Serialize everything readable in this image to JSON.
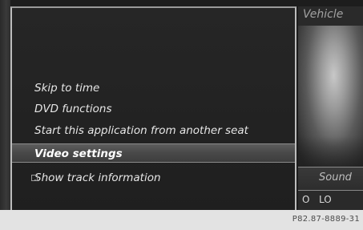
{
  "menu": {
    "items": [
      {
        "label": "Skip to time"
      },
      {
        "label": "DVD functions"
      },
      {
        "label": "Start this application from another seat"
      },
      {
        "label": "Video settings"
      },
      {
        "label": "Show track information"
      }
    ],
    "selected_index": 3
  },
  "right_panel": {
    "vehicle_label": "Vehicle",
    "sound_label": "Sound",
    "sound_values": [
      "O",
      "LO"
    ]
  },
  "reference_code": "P82.87-8889-31"
}
